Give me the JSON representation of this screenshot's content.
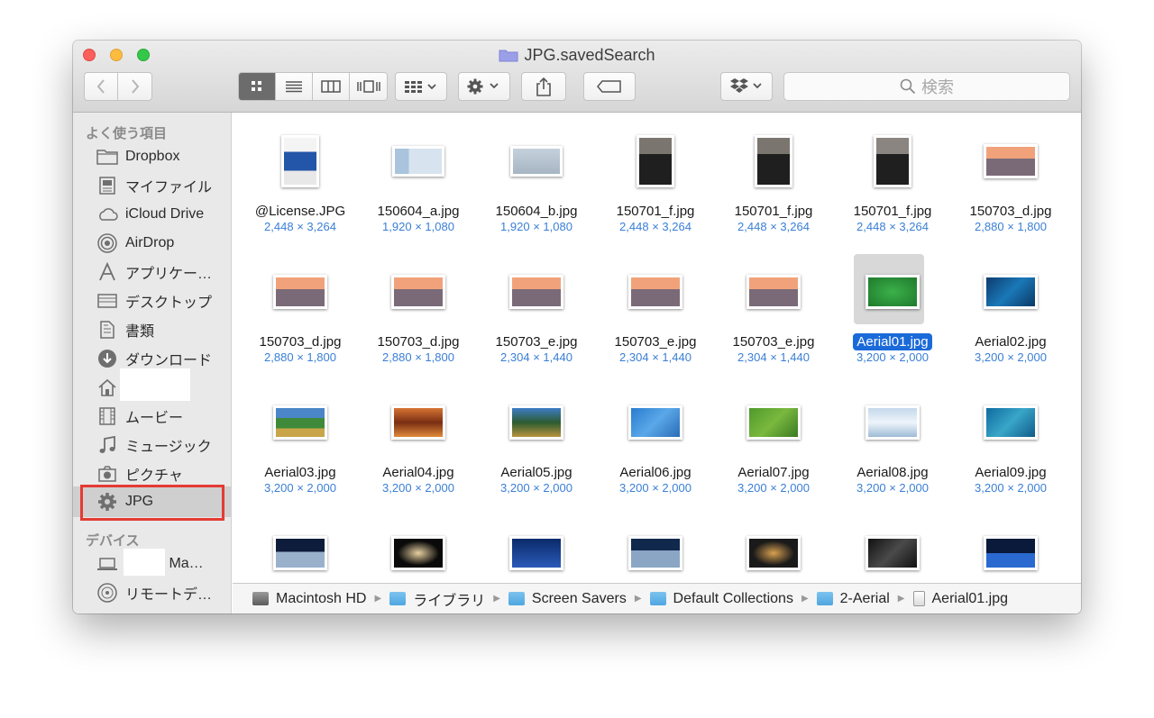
{
  "window": {
    "title": "JPG.savedSearch"
  },
  "toolbar": {
    "search_placeholder": "検索",
    "icons": [
      "back-icon",
      "forward-icon",
      "icon-view-icon",
      "list-view-icon",
      "column-view-icon",
      "coverflow-view-icon",
      "arrange-icon",
      "gear-icon",
      "share-icon",
      "tag-icon",
      "dropbox-icon",
      "search-icon"
    ]
  },
  "sidebar": {
    "favorites_header": "よく使う項目",
    "items": [
      {
        "label": "Dropbox",
        "icon": "folder-icon"
      },
      {
        "label": "マイファイル",
        "icon": "all-my-files-icon"
      },
      {
        "label": "iCloud Drive",
        "icon": "cloud-icon"
      },
      {
        "label": "AirDrop",
        "icon": "airdrop-icon"
      },
      {
        "label": "アプリケー…",
        "icon": "applications-icon"
      },
      {
        "label": "デスクトップ",
        "icon": "desktop-icon"
      },
      {
        "label": "書類",
        "icon": "documents-icon"
      },
      {
        "label": "ダウンロード",
        "icon": "download-icon"
      },
      {
        "label": "",
        "icon": "home-icon"
      },
      {
        "label": "ムービー",
        "icon": "movies-icon"
      },
      {
        "label": "ミュージック",
        "icon": "music-icon"
      },
      {
        "label": "ピクチャ",
        "icon": "camera-icon"
      },
      {
        "label": "JPG",
        "icon": "gear-icon"
      }
    ],
    "devices_header": "デバイス",
    "devices": [
      {
        "label": "s Ma…",
        "icon": "laptop-icon"
      },
      {
        "label": "リモートデ…",
        "icon": "disc-icon"
      }
    ]
  },
  "files": [
    {
      "name": "@License.JPG",
      "dims": "2,448 × 3,264"
    },
    {
      "name": "150604_a.jpg",
      "dims": "1,920 × 1,080"
    },
    {
      "name": "150604_b.jpg",
      "dims": "1,920 × 1,080"
    },
    {
      "name": "150701_f.jpg",
      "dims": "2,448 × 3,264"
    },
    {
      "name": "150701_f.jpg",
      "dims": "2,448 × 3,264"
    },
    {
      "name": "150701_f.jpg",
      "dims": "2,448 × 3,264"
    },
    {
      "name": "150703_d.jpg",
      "dims": "2,880 × 1,800"
    },
    {
      "name": "150703_d.jpg",
      "dims": "2,880 × 1,800"
    },
    {
      "name": "150703_d.jpg",
      "dims": "2,880 × 1,800"
    },
    {
      "name": "150703_e.jpg",
      "dims": "2,304 × 1,440"
    },
    {
      "name": "150703_e.jpg",
      "dims": "2,304 × 1,440"
    },
    {
      "name": "150703_e.jpg",
      "dims": "2,304 × 1,440"
    },
    {
      "name": "Aerial01.jpg",
      "dims": "3,200 × 2,000"
    },
    {
      "name": "Aerial02.jpg",
      "dims": "3,200 × 2,000"
    },
    {
      "name": "Aerial03.jpg",
      "dims": "3,200 × 2,000"
    },
    {
      "name": "Aerial04.jpg",
      "dims": "3,200 × 2,000"
    },
    {
      "name": "Aerial05.jpg",
      "dims": "3,200 × 2,000"
    },
    {
      "name": "Aerial06.jpg",
      "dims": "3,200 × 2,000"
    },
    {
      "name": "Aerial07.jpg",
      "dims": "3,200 × 2,000"
    },
    {
      "name": "Aerial08.jpg",
      "dims": "3,200 × 2,000"
    },
    {
      "name": "Aerial09.jpg",
      "dims": "3,200 × 2,000"
    },
    {
      "name": "",
      "dims": ""
    },
    {
      "name": "",
      "dims": ""
    },
    {
      "name": "",
      "dims": ""
    },
    {
      "name": "",
      "dims": ""
    },
    {
      "name": "",
      "dims": ""
    },
    {
      "name": "",
      "dims": ""
    },
    {
      "name": "",
      "dims": ""
    }
  ],
  "selected_file": "Aerial01.jpg",
  "pathbar": [
    {
      "label": "Macintosh HD",
      "icon": "hard-drive-icon"
    },
    {
      "label": "ライブラリ",
      "icon": "library-folder-icon"
    },
    {
      "label": "Screen Savers",
      "icon": "folder-icon"
    },
    {
      "label": "Default Collections",
      "icon": "folder-icon"
    },
    {
      "label": "2-Aerial",
      "icon": "folder-icon"
    },
    {
      "label": "Aerial01.jpg",
      "icon": "image-file-icon"
    }
  ]
}
